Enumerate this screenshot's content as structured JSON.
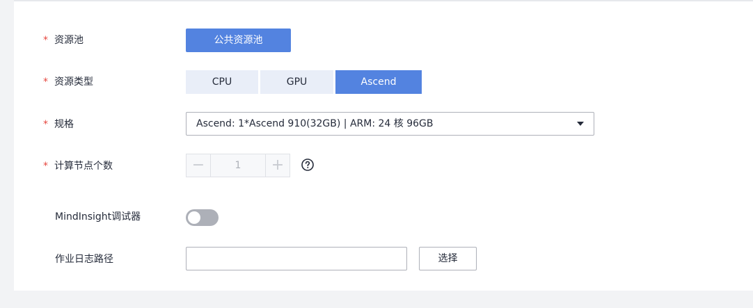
{
  "form": {
    "resource_pool": {
      "required_mark": "*",
      "label": "资源池",
      "button": "公共资源池"
    },
    "resource_type": {
      "required_mark": "*",
      "label": "资源类型",
      "options": [
        {
          "label": "CPU",
          "selected": false
        },
        {
          "label": "GPU",
          "selected": false
        },
        {
          "label": "Ascend",
          "selected": true
        }
      ]
    },
    "spec": {
      "required_mark": "*",
      "label": "规格",
      "selected_value": "Ascend: 1*Ascend 910(32GB) | ARM: 24 核 96GB"
    },
    "node_count": {
      "required_mark": "*",
      "label": "计算节点个数",
      "minus": "−",
      "value": "1",
      "plus": "+",
      "help_icon": "question-circle-icon"
    },
    "mindinsight": {
      "label": "MindInsight调试器",
      "enabled": false
    },
    "log_path": {
      "label": "作业日志路径",
      "value": "",
      "select_button": "选择"
    }
  },
  "colors": {
    "primary": "#5383e0",
    "segment_inactive": "#e9eef8",
    "required": "#e6473f",
    "toggle_off": "#adb0b8",
    "background": "#f2f3f5"
  }
}
